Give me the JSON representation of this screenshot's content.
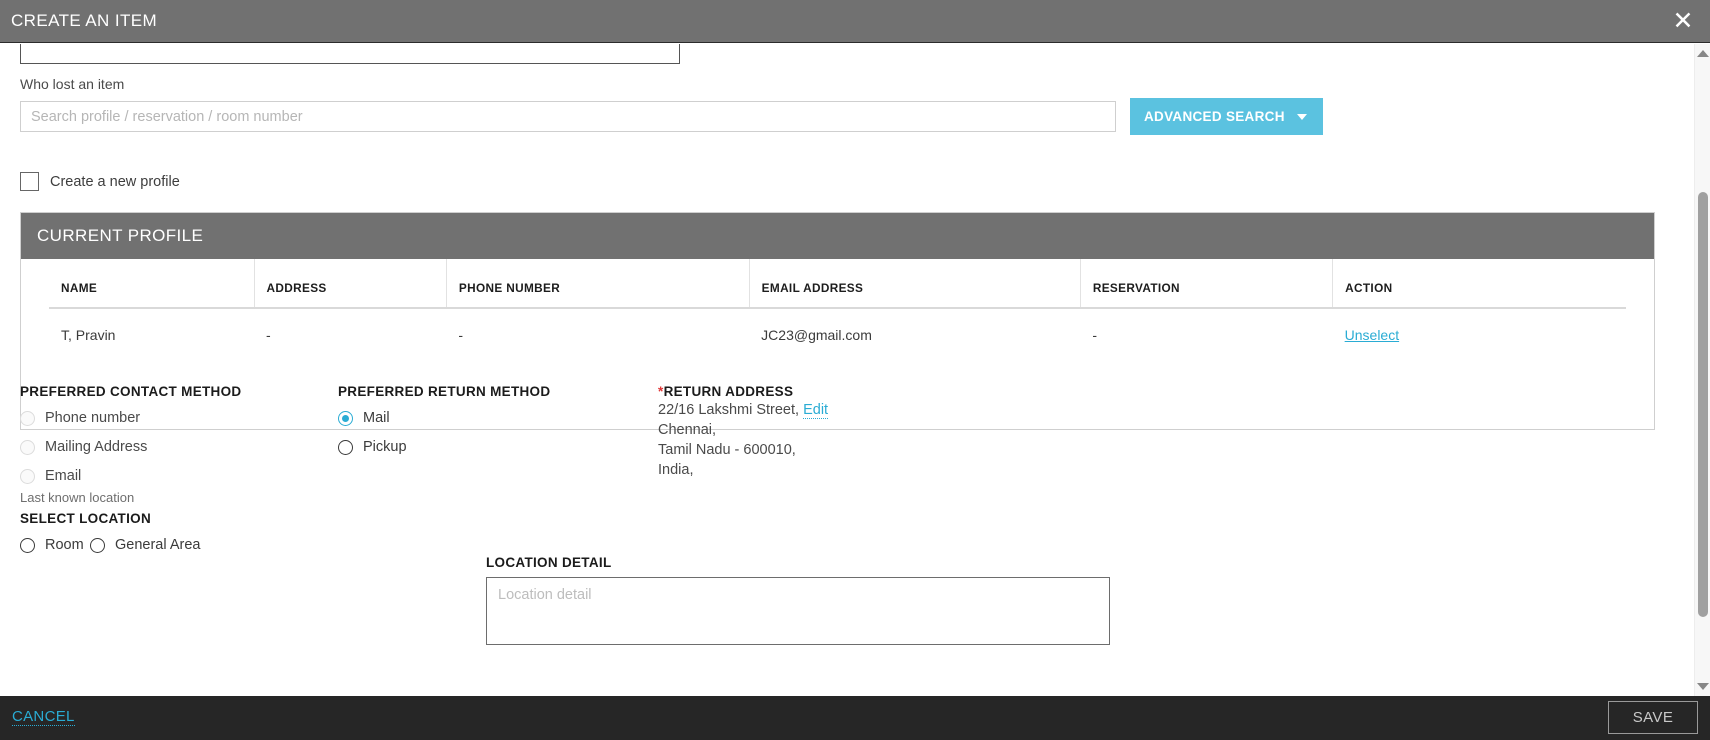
{
  "window": {
    "title": "CREATE AN ITEM",
    "close_icon": "close-icon"
  },
  "form": {
    "who_lost_label": "Who lost an item",
    "search_placeholder": "Search profile / reservation / room number",
    "search_value": "",
    "advanced_search_label": "ADVANCED SEARCH",
    "create_new_profile_label": "Create a new profile"
  },
  "current_profile": {
    "panel_title": "CURRENT PROFILE",
    "columns": [
      "NAME",
      "ADDRESS",
      "PHONE NUMBER",
      "EMAIL ADDRESS",
      "RESERVATION",
      "ACTION"
    ],
    "rows": [
      {
        "name": "T, Pravin",
        "address": "-",
        "phone_number": "-",
        "email_address": "JC23@gmail.com",
        "reservation": "-",
        "action": "Unselect"
      }
    ]
  },
  "preferred_contact_method": {
    "title": "PREFERRED CONTACT METHOD",
    "options": [
      {
        "label": "Phone number",
        "selected": false,
        "disabled": true
      },
      {
        "label": "Mailing Address",
        "selected": false,
        "disabled": true
      },
      {
        "label": "Email",
        "selected": false,
        "disabled": true
      }
    ]
  },
  "preferred_return_method": {
    "title": "PREFERRED RETURN METHOD",
    "options": [
      {
        "label": "Mail",
        "selected": true,
        "disabled": false
      },
      {
        "label": "Pickup",
        "selected": false,
        "disabled": false
      }
    ]
  },
  "return_address": {
    "required_marker": "*",
    "title": "RETURN ADDRESS",
    "line1": "22/16 Lakshmi Street,",
    "edit_label": "Edit",
    "line2": "Chennai,",
    "line3": "Tamil Nadu - 600010,",
    "line4": "India,"
  },
  "location": {
    "hint": "Last known location",
    "select_location_title": "SELECT LOCATION",
    "options": [
      {
        "label": "Room",
        "selected": false
      },
      {
        "label": "General Area",
        "selected": false
      }
    ],
    "detail_title": "LOCATION DETAIL",
    "detail_placeholder": "Location detail",
    "detail_value": ""
  },
  "footer": {
    "cancel_label": "CANCEL",
    "save_label": "SAVE"
  },
  "colors": {
    "accent": "#2aacd4",
    "button_blue": "#5bc2e0",
    "header_gray": "#717171",
    "footer_dark": "#262626",
    "required_red": "#e03535"
  }
}
